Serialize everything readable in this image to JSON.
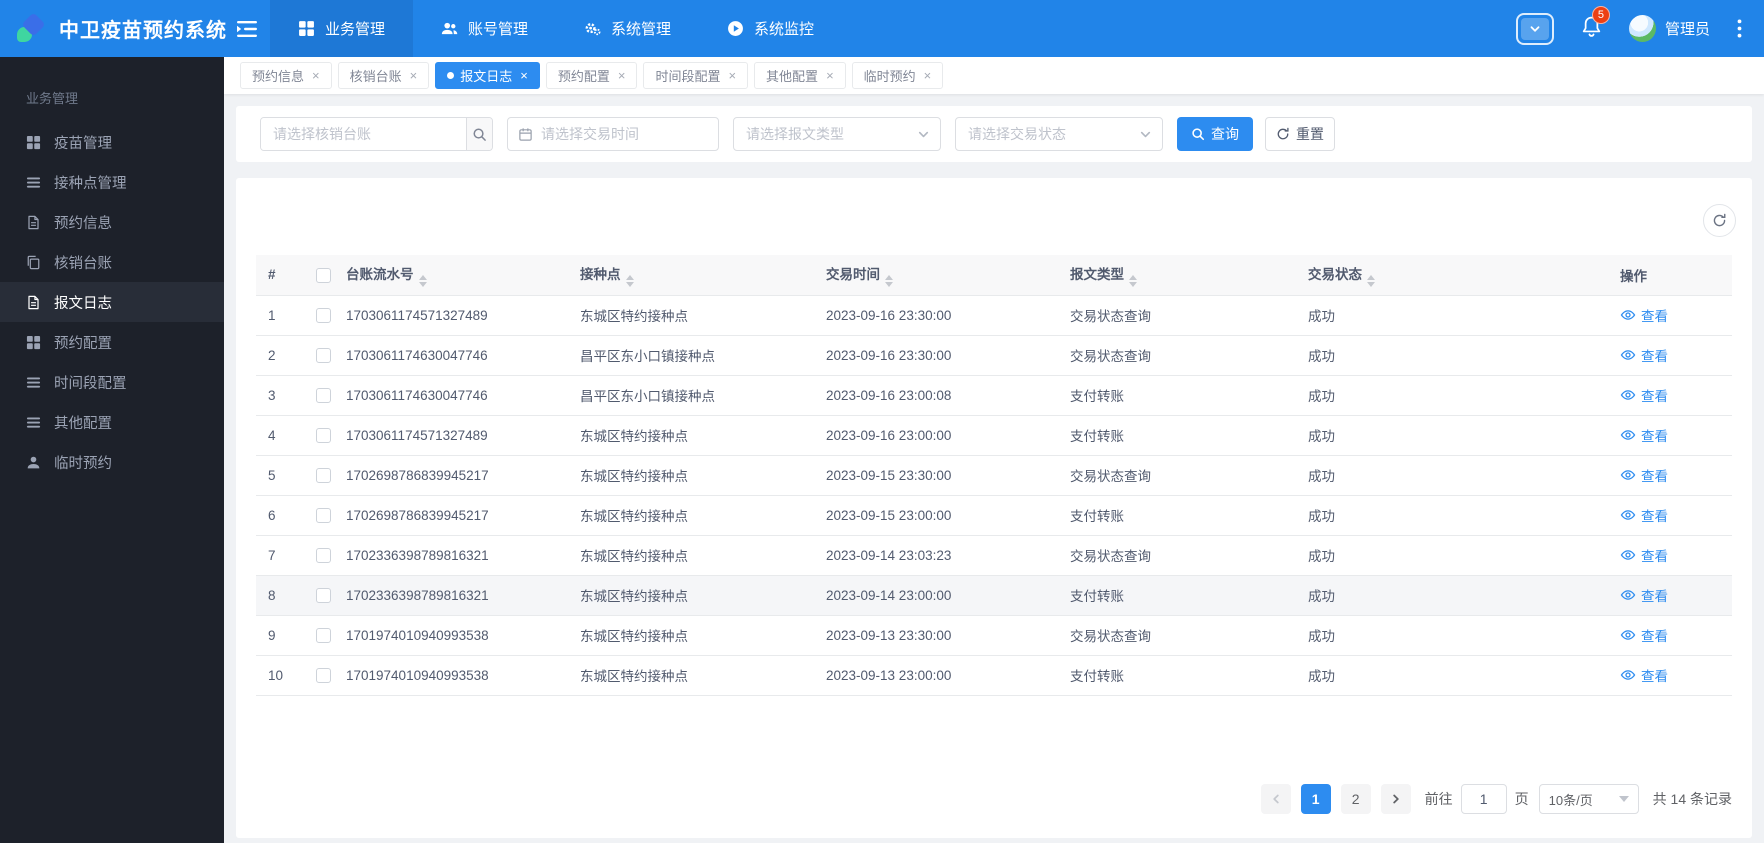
{
  "colors": {
    "primary": "#2d8cf0",
    "navbar_bg": "#2184e8",
    "navbar_active_bg": "#1e78d6",
    "sidebar_bg": "#1d212a",
    "badge_red": "#ed4014",
    "table_header_bg": "#f8f8f9",
    "border": "#e8eaec"
  },
  "navbar": {
    "title": "中卫疫苗预约系统",
    "menus": [
      {
        "label": "业务管理",
        "icon": "grid-icon",
        "active": true
      },
      {
        "label": "账号管理",
        "icon": "users-icon",
        "active": false
      },
      {
        "label": "系统管理",
        "icon": "gears-icon",
        "active": false
      },
      {
        "label": "系统监控",
        "icon": "monitor-icon",
        "active": false
      }
    ],
    "notification_count": "5",
    "user_name": "管理员"
  },
  "sidebar": {
    "group_label": "业务管理",
    "items": [
      {
        "label": "疫苗管理",
        "icon": "grid-icon",
        "active": false
      },
      {
        "label": "接种点管理",
        "icon": "list-icon",
        "active": false
      },
      {
        "label": "预约信息",
        "icon": "document-icon",
        "active": false
      },
      {
        "label": "核销台账",
        "icon": "copy-icon",
        "active": false
      },
      {
        "label": "报文日志",
        "icon": "document-icon",
        "active": true
      },
      {
        "label": "预约配置",
        "icon": "grid-icon",
        "active": false
      },
      {
        "label": "时间段配置",
        "icon": "list-icon",
        "active": false
      },
      {
        "label": "其他配置",
        "icon": "list-icon",
        "active": false
      },
      {
        "label": "临时预约",
        "icon": "user-icon",
        "active": false
      }
    ]
  },
  "tabs": [
    {
      "label": "预约信息",
      "active": false
    },
    {
      "label": "核销台账",
      "active": false
    },
    {
      "label": "报文日志",
      "active": true
    },
    {
      "label": "预约配置",
      "active": false
    },
    {
      "label": "时间段配置",
      "active": false
    },
    {
      "label": "其他配置",
      "active": false
    },
    {
      "label": "临时预约",
      "active": false
    }
  ],
  "filters": {
    "search_placeholder": "请选择核销台账",
    "date_placeholder": "请选择交易时间",
    "type_placeholder": "请选择报文类型",
    "status_placeholder": "请选择交易状态",
    "query_label": "查询",
    "reset_label": "重置"
  },
  "table": {
    "columns": [
      {
        "label": "#",
        "sortable": false
      },
      {
        "label": "台账流水号",
        "sortable": true
      },
      {
        "label": "接种点",
        "sortable": true
      },
      {
        "label": "交易时间",
        "sortable": true
      },
      {
        "label": "报文类型",
        "sortable": true
      },
      {
        "label": "交易状态",
        "sortable": true
      },
      {
        "label": "操作",
        "sortable": false
      }
    ],
    "view_label": "查看",
    "rows": [
      {
        "index": "1",
        "serial": "1703061174571327489",
        "site": "东城区特约接种点",
        "time": "2023-09-16 23:30:00",
        "type": "交易状态查询",
        "status": "成功",
        "highlighted": false
      },
      {
        "index": "2",
        "serial": "1703061174630047746",
        "site": "昌平区东小口镇接种点",
        "time": "2023-09-16 23:30:00",
        "type": "交易状态查询",
        "status": "成功",
        "highlighted": false
      },
      {
        "index": "3",
        "serial": "1703061174630047746",
        "site": "昌平区东小口镇接种点",
        "time": "2023-09-16 23:00:08",
        "type": "支付转账",
        "status": "成功",
        "highlighted": false
      },
      {
        "index": "4",
        "serial": "1703061174571327489",
        "site": "东城区特约接种点",
        "time": "2023-09-16 23:00:00",
        "type": "支付转账",
        "status": "成功",
        "highlighted": false
      },
      {
        "index": "5",
        "serial": "1702698786839945217",
        "site": "东城区特约接种点",
        "time": "2023-09-15 23:30:00",
        "type": "交易状态查询",
        "status": "成功",
        "highlighted": false
      },
      {
        "index": "6",
        "serial": "1702698786839945217",
        "site": "东城区特约接种点",
        "time": "2023-09-15 23:00:00",
        "type": "支付转账",
        "status": "成功",
        "highlighted": false
      },
      {
        "index": "7",
        "serial": "1702336398789816321",
        "site": "东城区特约接种点",
        "time": "2023-09-14 23:03:23",
        "type": "交易状态查询",
        "status": "成功",
        "highlighted": false
      },
      {
        "index": "8",
        "serial": "1702336398789816321",
        "site": "东城区特约接种点",
        "time": "2023-09-14 23:00:00",
        "type": "支付转账",
        "status": "成功",
        "highlighted": true
      },
      {
        "index": "9",
        "serial": "1701974010940993538",
        "site": "东城区特约接种点",
        "time": "2023-09-13 23:30:00",
        "type": "交易状态查询",
        "status": "成功",
        "highlighted": false
      },
      {
        "index": "10",
        "serial": "1701974010940993538",
        "site": "东城区特约接种点",
        "time": "2023-09-13 23:00:00",
        "type": "支付转账",
        "status": "成功",
        "highlighted": false
      }
    ]
  },
  "pagination": {
    "prev_disabled": true,
    "pages": [
      "1",
      "2"
    ],
    "current_page": "1",
    "goto_label": "前往",
    "goto_value": "1",
    "page_unit_label": "页",
    "page_size_label": "10条/页",
    "total_label": "共 14 条记录"
  }
}
